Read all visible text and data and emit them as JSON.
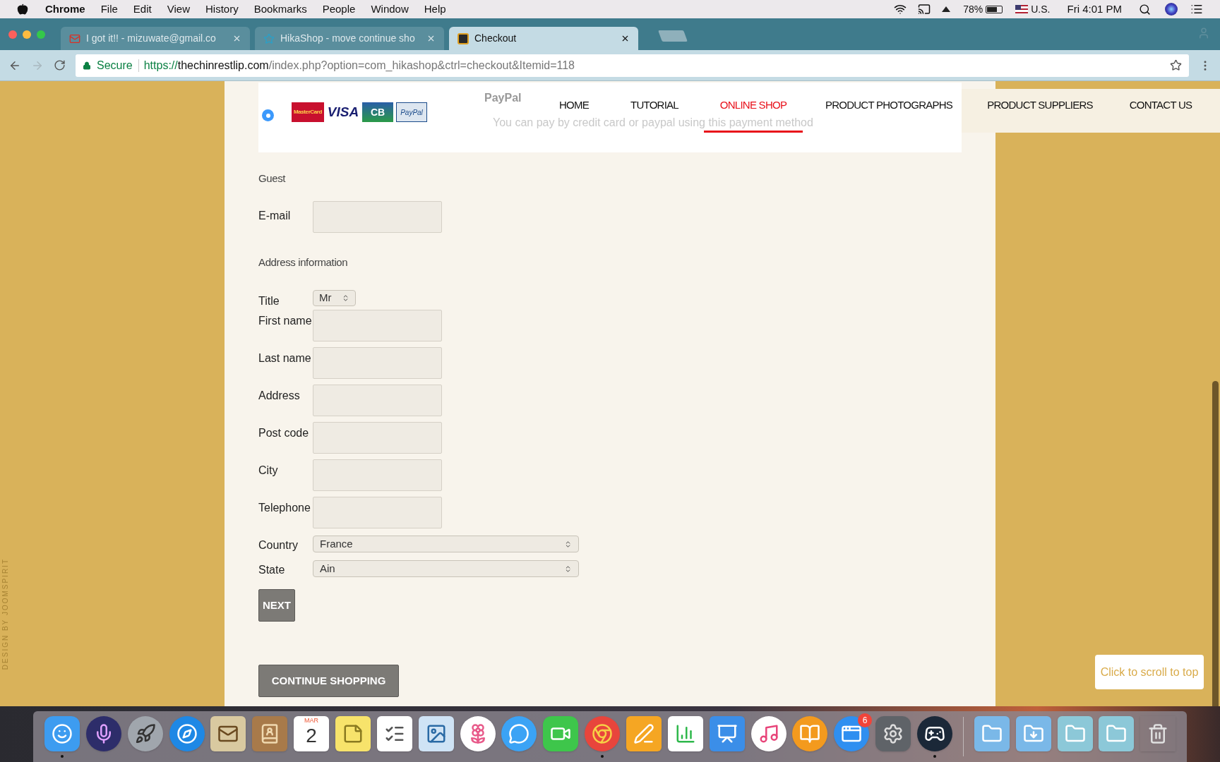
{
  "menu_bar": {
    "app": "Chrome",
    "menus": [
      "File",
      "Edit",
      "View",
      "History",
      "Bookmarks",
      "People",
      "Window",
      "Help"
    ],
    "battery_percent": "78%",
    "input_source": "U.S.",
    "clock": "Fri 4:01 PM"
  },
  "tabs": [
    {
      "title": "I got it!! - mizuwate@gmail.co",
      "selected": false,
      "kind": "mail"
    },
    {
      "title": "HikaShop - move continue sho",
      "selected": false,
      "kind": "star"
    },
    {
      "title": "Checkout",
      "selected": true,
      "kind": "shop"
    }
  ],
  "address_bar": {
    "secure_label": "Secure",
    "scheme": "https://",
    "domain": "thechinrestlip.com",
    "path": "/index.php?option=com_hikashop&ctrl=checkout&Itemid=118"
  },
  "nav": [
    {
      "label": "HOME",
      "selected": false
    },
    {
      "label": "TUTORIAL",
      "selected": false
    },
    {
      "label": "ONLINE SHOP",
      "selected": true
    },
    {
      "label": "PRODUCT PHOTOGRAPHS",
      "selected": false
    },
    {
      "label": "PRODUCT SUPPLIERS",
      "selected": false
    },
    {
      "label": "CONTACT US",
      "selected": false
    }
  ],
  "payment": {
    "selected": true,
    "logos": [
      "MasterCard",
      "VISA",
      "CB",
      "PayPal"
    ],
    "name": "PayPal",
    "description": "You can pay by credit card or paypal using this payment method"
  },
  "form": {
    "guest_heading": "Guest",
    "email_label": "E-mail",
    "address_heading": "Address information",
    "fields": [
      {
        "kind": "select",
        "label": "Title",
        "value": "Mr"
      },
      {
        "kind": "text",
        "label": "First name"
      },
      {
        "kind": "text",
        "label": "Last name"
      },
      {
        "kind": "text",
        "label": "Address"
      },
      {
        "kind": "text",
        "label": "Post code"
      },
      {
        "kind": "text",
        "label": "City"
      },
      {
        "kind": "text",
        "label": "Telephone"
      },
      {
        "kind": "wide_select",
        "label": "Country",
        "value": "France"
      },
      {
        "kind": "wide_select",
        "label": "State",
        "value": "Ain"
      }
    ],
    "next_button": "NEXT",
    "continue_button": "CONTINUE SHOPPING"
  },
  "side_credit": "DESIGN BY JOOMSPIRIT",
  "scroll_top": "Click to scroll to top",
  "dock": [
    {
      "kind": "app",
      "running": true
    },
    {
      "kind": "app",
      "running": false
    },
    {
      "kind": "app",
      "running": false
    },
    {
      "kind": "app",
      "running": false
    },
    {
      "kind": "app",
      "running": false
    },
    {
      "kind": "app",
      "running": false
    },
    {
      "kind": "calendar",
      "running": false,
      "month": "MAR",
      "day": "2"
    },
    {
      "kind": "app",
      "running": false
    },
    {
      "kind": "app",
      "running": false
    },
    {
      "kind": "app",
      "running": false
    },
    {
      "kind": "app",
      "running": false
    },
    {
      "kind": "app",
      "running": false
    },
    {
      "kind": "app",
      "running": false
    },
    {
      "kind": "app",
      "running": true
    },
    {
      "kind": "app",
      "running": false
    },
    {
      "kind": "app",
      "running": false
    },
    {
      "kind": "app",
      "running": false
    },
    {
      "kind": "app",
      "running": false
    },
    {
      "kind": "app",
      "running": false
    },
    {
      "kind": "app",
      "running": false,
      "badge": "6"
    },
    {
      "kind": "app",
      "running": false
    },
    {
      "kind": "app",
      "running": true
    },
    {
      "kind": "app",
      "running": false
    },
    {
      "kind": "app",
      "running": false
    },
    {
      "kind": "app",
      "running": false
    },
    {
      "kind": "app",
      "running": false
    },
    {
      "kind": "app",
      "running": false
    }
  ]
}
